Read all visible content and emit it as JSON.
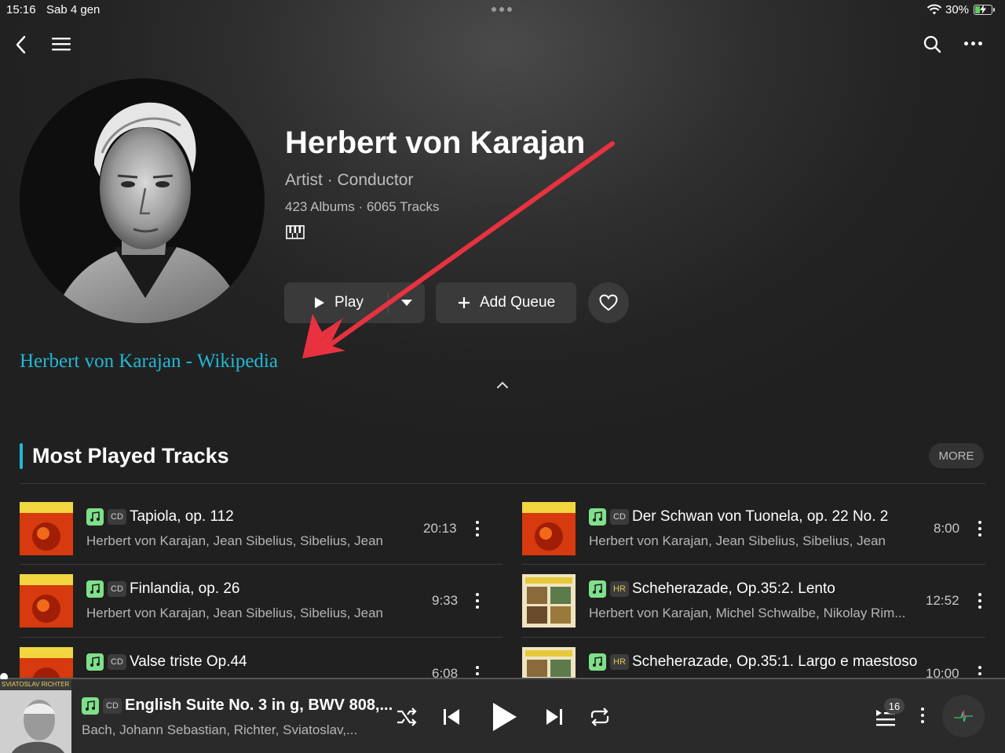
{
  "status": {
    "time": "15:16",
    "date": "Sab 4 gen",
    "battery": "30%"
  },
  "artist": {
    "name": "Herbert von Karajan",
    "role": "Artist · Conductor",
    "counts": "423 Albums · 6065 Tracks",
    "wiki_link": "Herbert von Karajan - Wikipedia"
  },
  "actions": {
    "play": "Play",
    "add_queue": "Add Queue"
  },
  "section": {
    "title": "Most Played Tracks",
    "more": "MORE"
  },
  "tracks": [
    {
      "title": "Tapiola, op. 112",
      "badge": "CD",
      "artists": "Herbert von Karajan, Jean Sibelius, Sibelius, Jean",
      "duration": "20:13"
    },
    {
      "title": "Der Schwan von Tuonela, op. 22 No. 2",
      "badge": "CD",
      "artists": "Herbert von Karajan, Jean Sibelius, Sibelius, Jean",
      "duration": "8:00"
    },
    {
      "title": "Finlandia, op. 26",
      "badge": "CD",
      "artists": "Herbert von Karajan, Jean Sibelius, Sibelius, Jean",
      "duration": "9:33"
    },
    {
      "title": "Scheherazade, Op.35:2. Lento",
      "badge": "HR",
      "artists": "Herbert von Karajan, Michel Schwalbe, Nikolay Rim...",
      "duration": "12:52"
    },
    {
      "title": "Valse triste Op.44",
      "badge": "CD",
      "artists": "",
      "duration": "6:08"
    },
    {
      "title": "Scheherazade, Op.35:1. Largo e maestoso",
      "badge": "HR",
      "artists": "",
      "duration": "10:00"
    }
  ],
  "now_playing": {
    "title": "English Suite No. 3 in g, BWV 808,...",
    "badge": "CD",
    "artists": "Bach, Johann Sebastian, Richter, Sviatoslav,...",
    "album_text": "SVIATOSLAV RICHTER",
    "queue_count": "16"
  },
  "colors": {
    "accent": "#21b8d6",
    "quality_badge": "#7fe08a",
    "hr_badge": "#e2c25a",
    "annotation_arrow": "#e8323f"
  }
}
